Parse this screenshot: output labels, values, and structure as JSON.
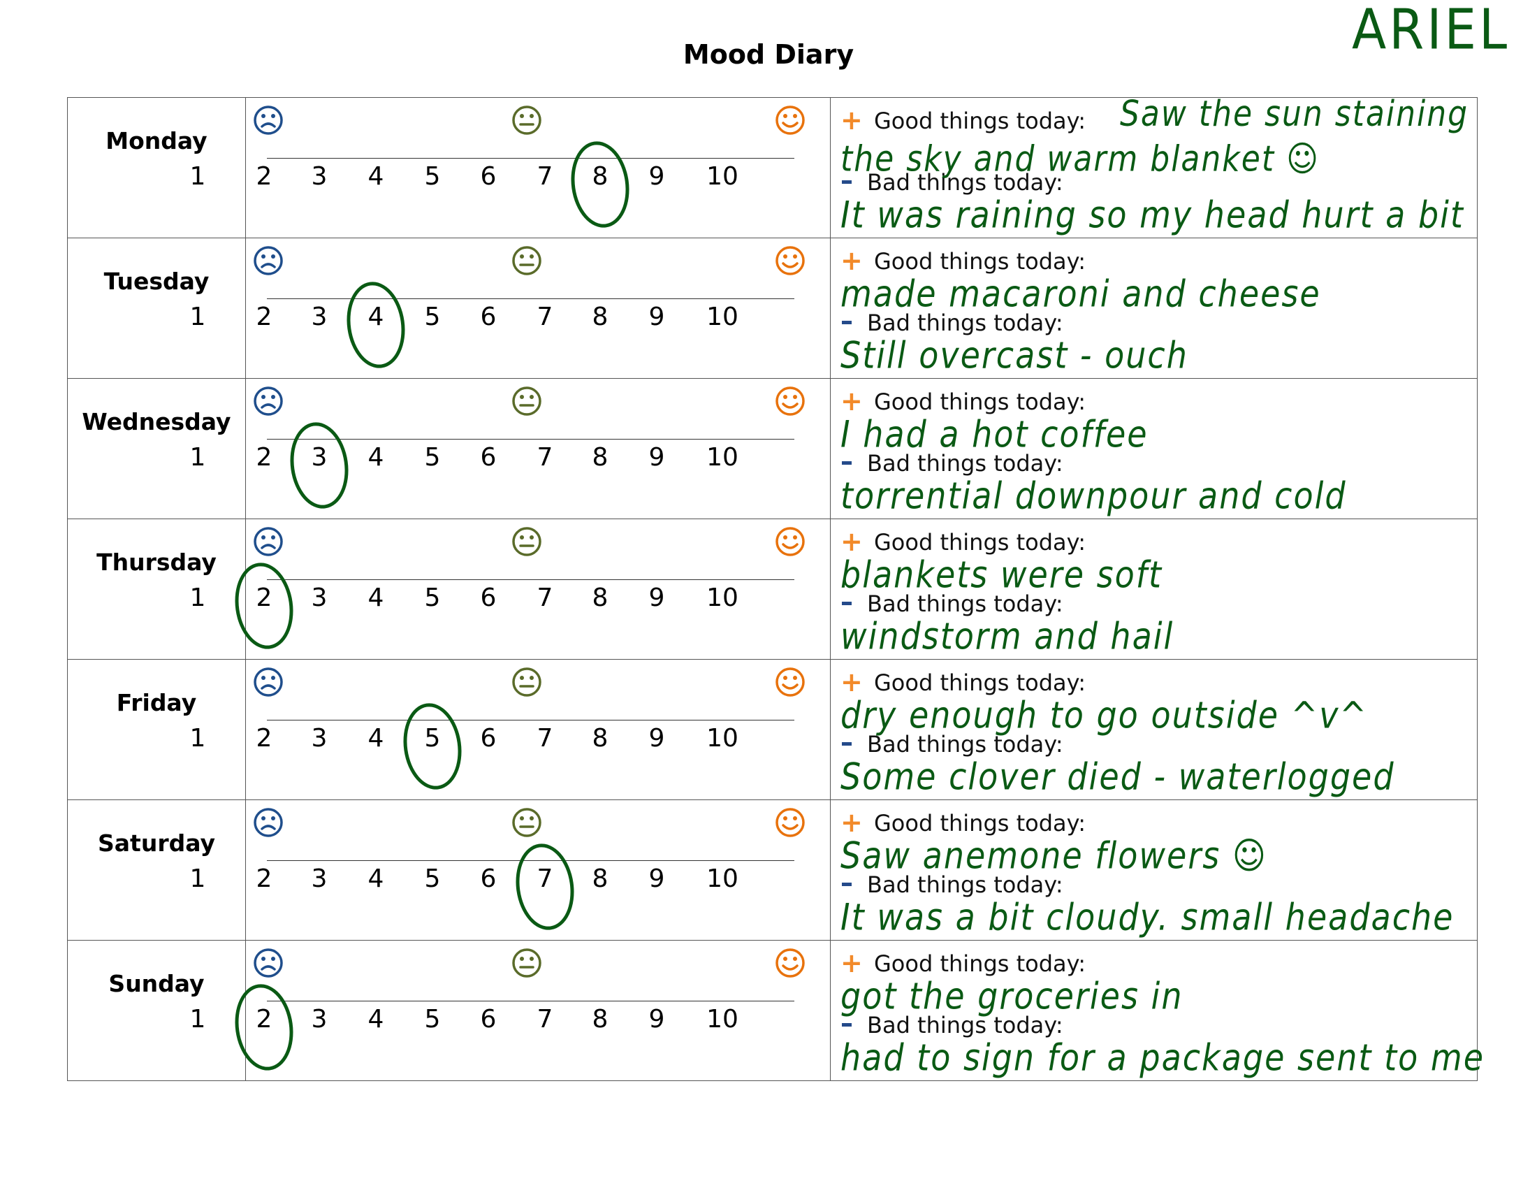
{
  "title": "Mood Diary",
  "name": "ARIEL",
  "labels": {
    "good": "Good things today:",
    "bad": "Bad things today:"
  },
  "scale": [
    "1",
    "2",
    "3",
    "4",
    "5",
    "6",
    "7",
    "8",
    "9",
    "10"
  ],
  "colors": {
    "sad": "#1f4e8c",
    "neutral": "#5a6b2a",
    "happy": "#e8720c",
    "ink": "#0a5a14",
    "plus": "#f28a2a",
    "minus": "#244a8a"
  },
  "icons": [
    "sad-face-icon",
    "neutral-face-icon",
    "happy-face-icon"
  ],
  "days": [
    {
      "day": "Monday",
      "mood": 8,
      "good": "Saw the sun staining the sky and warm blanket ☺",
      "bad": "It was raining so my head hurt a bit"
    },
    {
      "day": "Tuesday",
      "mood": 4,
      "good": "made macaroni and cheese",
      "bad": "Still overcast - ouch"
    },
    {
      "day": "Wednesday",
      "mood": 3,
      "good": "I had a hot coffee",
      "bad": "torrential downpour and cold"
    },
    {
      "day": "Thursday",
      "mood": 2,
      "good": "blankets were soft",
      "bad": "windstorm and hail"
    },
    {
      "day": "Friday",
      "mood": 5,
      "good": "dry enough to go outside ^v^",
      "bad": "Some clover died - waterlogged"
    },
    {
      "day": "Saturday",
      "mood": 7,
      "good": "Saw anemone flowers ☺",
      "bad": "It was a bit cloudy. small headache"
    },
    {
      "day": "Sunday",
      "mood": 2,
      "good": "got the groceries in",
      "bad": "had to sign for a package sent to me"
    }
  ]
}
